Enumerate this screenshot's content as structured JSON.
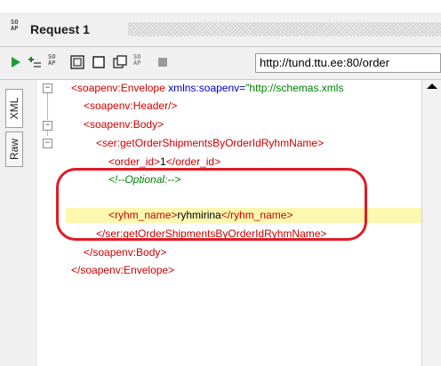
{
  "window": {
    "title": "Request 1",
    "icon_text": "so ap"
  },
  "toolbar": {
    "url": "http://tund.ttu.ee:80/order",
    "buttons": [
      {
        "name": "run-icon"
      },
      {
        "name": "add-assertion-icon"
      },
      {
        "name": "soap-icon"
      },
      {
        "name": "recreate-icon"
      },
      {
        "name": "square-icon"
      },
      {
        "name": "clone-icon"
      },
      {
        "name": "soap-icon-2"
      },
      {
        "name": "stop-icon"
      }
    ]
  },
  "side_tabs": {
    "xml": "XML",
    "raw": "Raw"
  },
  "editor": {
    "lines": [
      {
        "open": "<",
        "tag": "soapenv:Envelope",
        "attr": " xmlns:soapenv=",
        "value": "\"http://schemas.xmls"
      },
      {
        "text": "<soapenv:Header/>"
      },
      {
        "text": "<soapenv:Body>"
      },
      {
        "text": "<ser:getOrderShipmentsByOrderIdRyhmName>"
      },
      {
        "open": "<order_id>",
        "content": "1",
        "close": "</order_id>"
      },
      {
        "comment": "<!--Optional:-->"
      },
      {
        "open": "<ryhm_name>",
        "content": "ryhmirina",
        "close": "</ryhm_name>"
      },
      {
        "text": "</ser:getOrderShipmentsByOrderIdRyhmName>"
      },
      {
        "text": "</soapenv:Body>"
      },
      {
        "text": "</soapenv:Envelope>"
      }
    ]
  },
  "colors": {
    "tag": "#cc0000",
    "attribute": "#0000c8",
    "value": "#008000",
    "highlight": "#fdf8b0",
    "annotation": "#e01b24"
  }
}
